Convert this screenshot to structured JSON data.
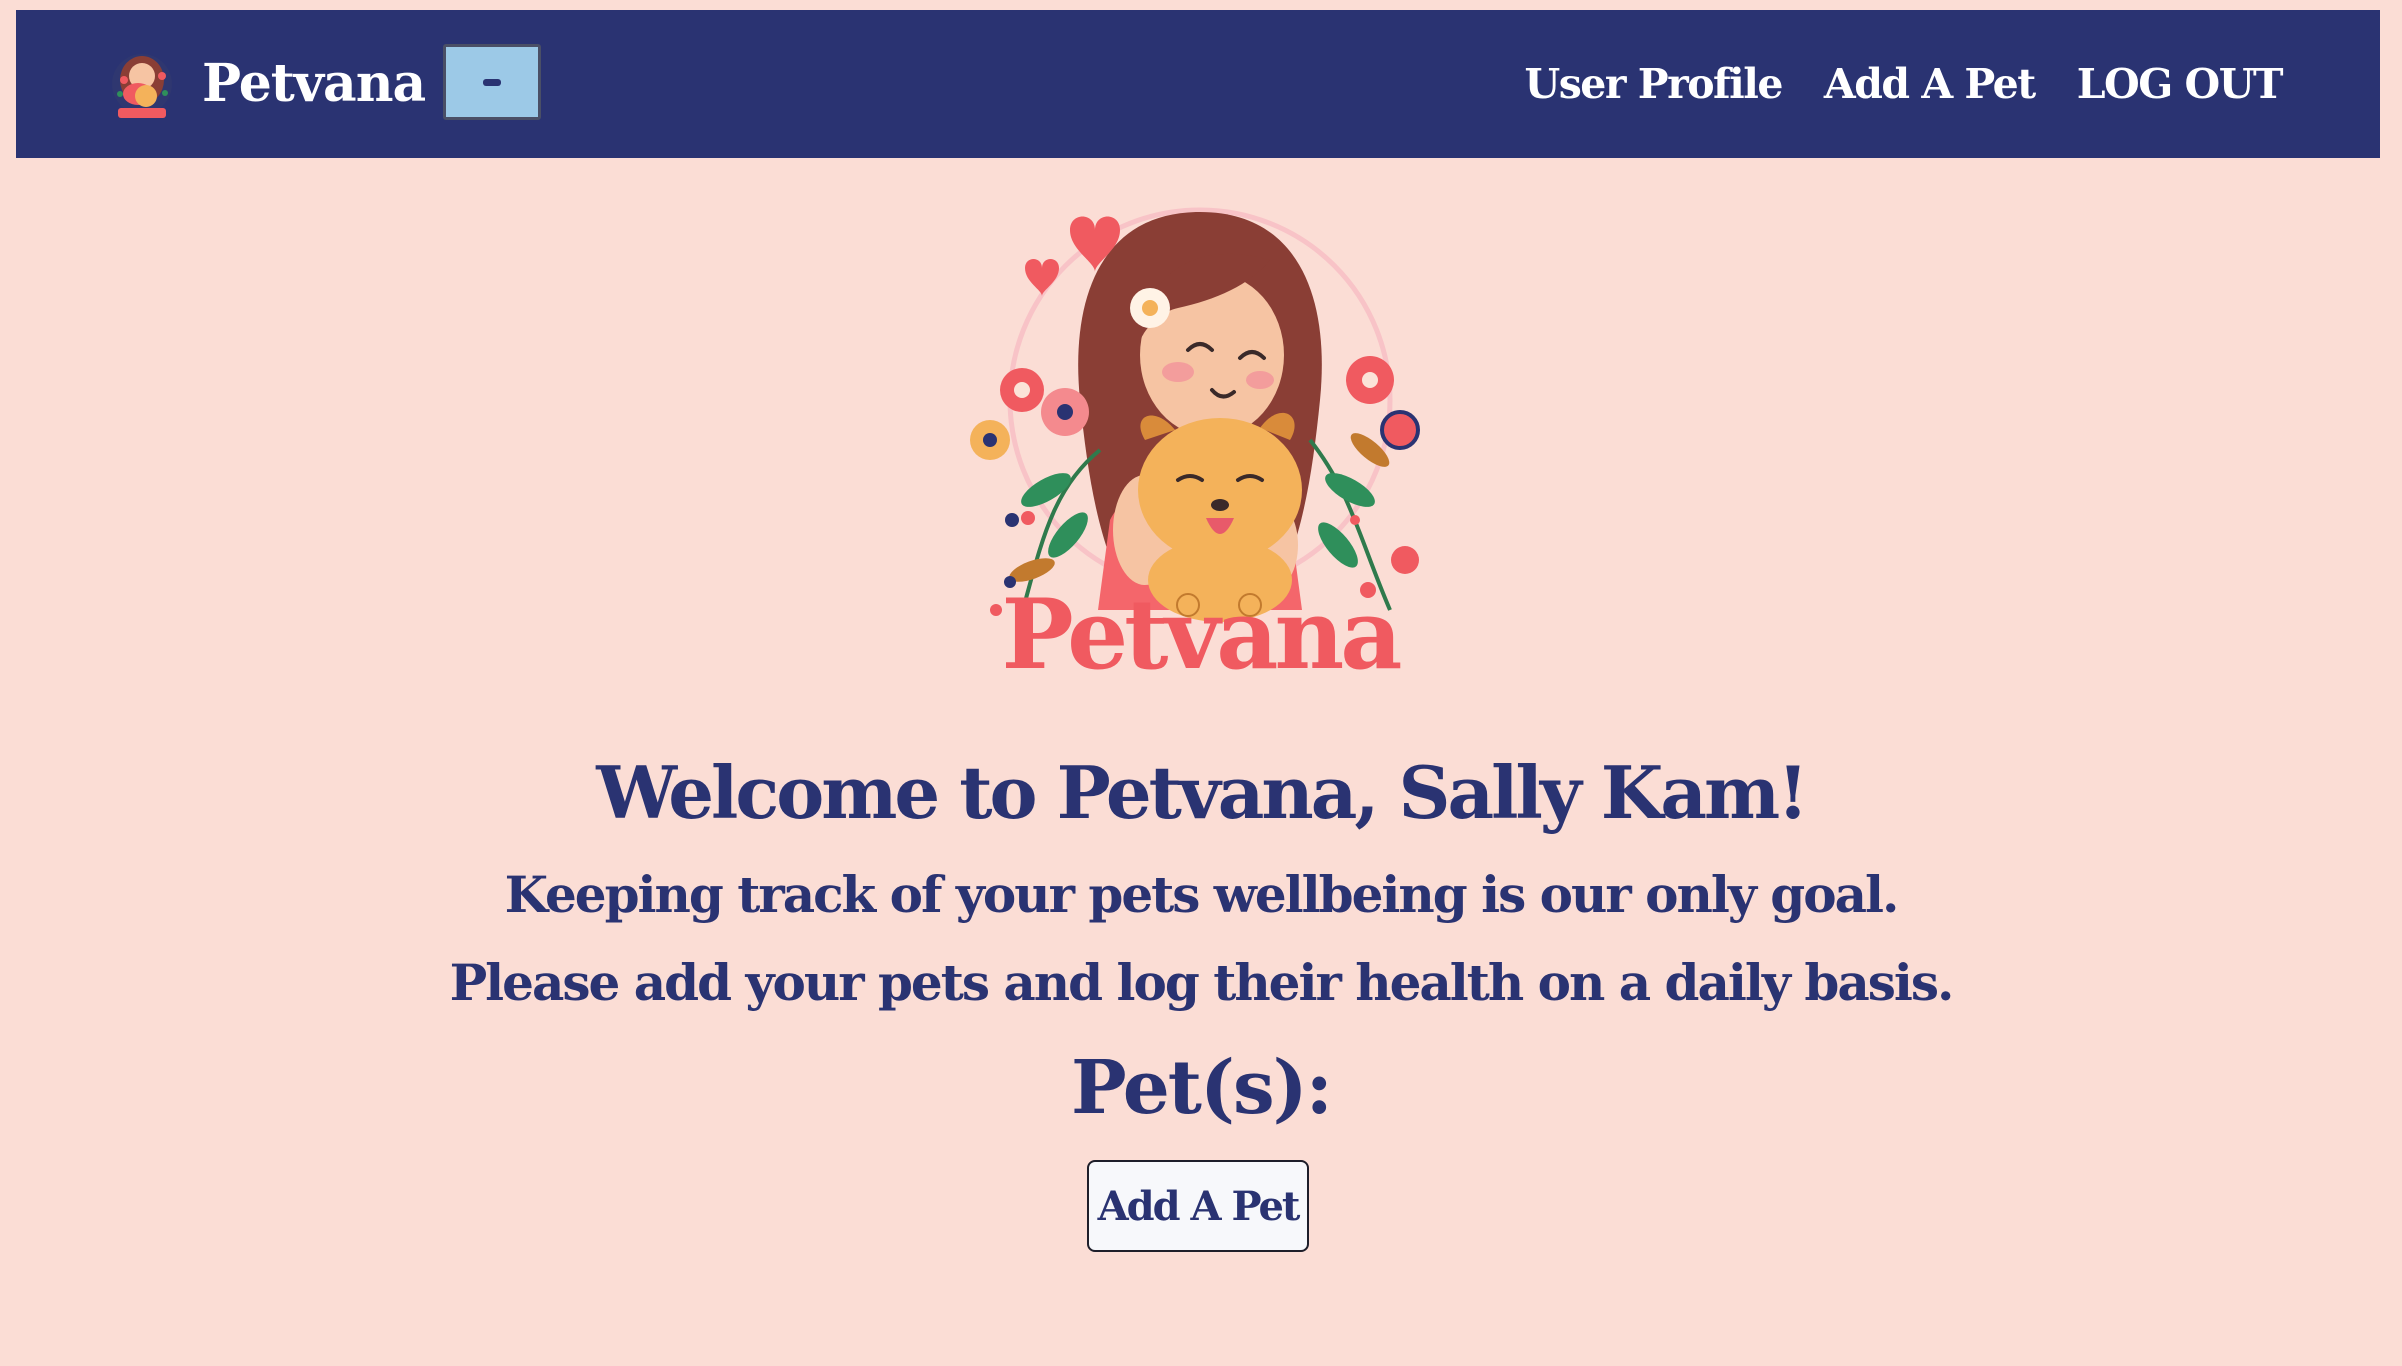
{
  "navbar": {
    "brand": "Petvana",
    "toggle_icon": "menu-toggle-icon",
    "links": [
      {
        "label": "User Profile"
      },
      {
        "label": "Add A Pet"
      },
      {
        "label": "LOG OUT"
      }
    ]
  },
  "hero": {
    "logo_text": "Petvana"
  },
  "main": {
    "welcome": "Welcome to Petvana, Sally Kam!",
    "tagline_1": "Keeping track of your pets wellbeing is our only goal.",
    "tagline_2": "Please add your pets and log their health on a daily basis.",
    "pets_heading": "Pet(s):",
    "add_pet_button": "Add A Pet"
  },
  "colors": {
    "background": "#FBDDD5",
    "navbar": "#2A3372",
    "heading_text": "#2A3372",
    "toggle_button": "#9CC9E7",
    "logo_pink": "#F05A60",
    "logo_hair": "#8A3E35",
    "logo_dog": "#F4B25A"
  }
}
